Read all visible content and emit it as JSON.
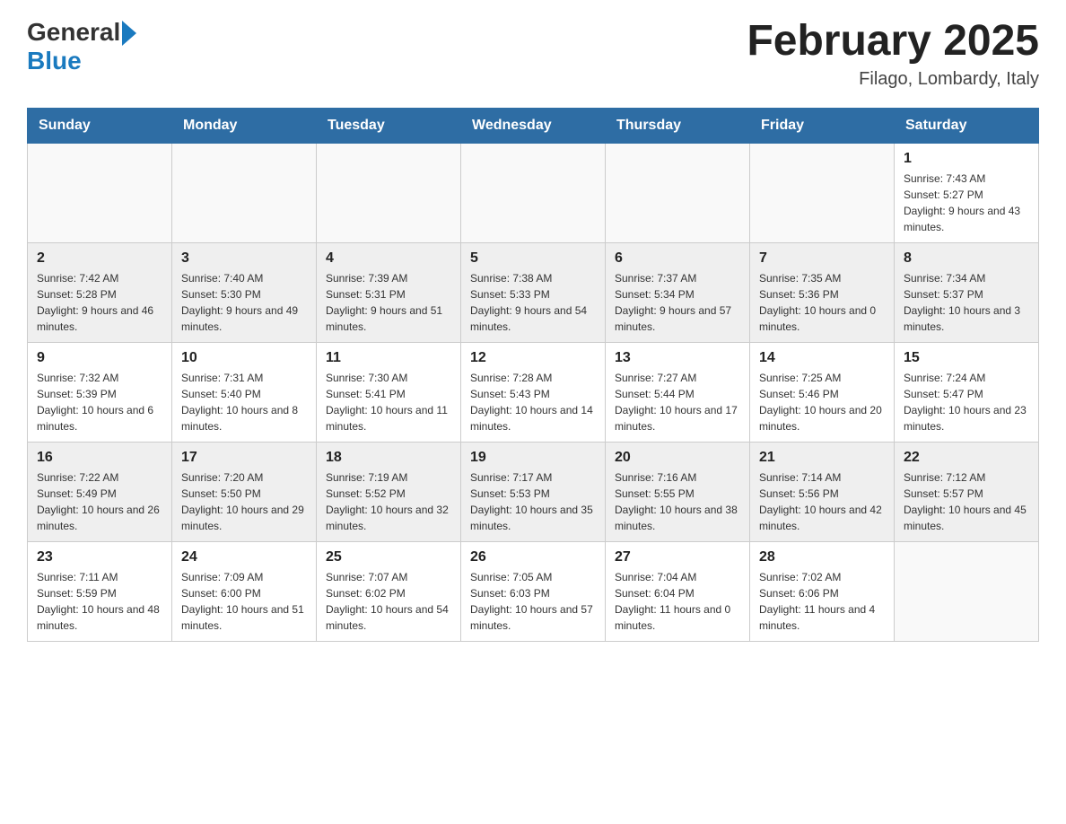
{
  "header": {
    "logo_general": "General",
    "logo_blue": "Blue",
    "title": "February 2025",
    "location": "Filago, Lombardy, Italy"
  },
  "weekdays": [
    "Sunday",
    "Monday",
    "Tuesday",
    "Wednesday",
    "Thursday",
    "Friday",
    "Saturday"
  ],
  "weeks": [
    {
      "days": [
        {
          "num": "",
          "info": ""
        },
        {
          "num": "",
          "info": ""
        },
        {
          "num": "",
          "info": ""
        },
        {
          "num": "",
          "info": ""
        },
        {
          "num": "",
          "info": ""
        },
        {
          "num": "",
          "info": ""
        },
        {
          "num": "1",
          "info": "Sunrise: 7:43 AM\nSunset: 5:27 PM\nDaylight: 9 hours and 43 minutes."
        }
      ]
    },
    {
      "days": [
        {
          "num": "2",
          "info": "Sunrise: 7:42 AM\nSunset: 5:28 PM\nDaylight: 9 hours and 46 minutes."
        },
        {
          "num": "3",
          "info": "Sunrise: 7:40 AM\nSunset: 5:30 PM\nDaylight: 9 hours and 49 minutes."
        },
        {
          "num": "4",
          "info": "Sunrise: 7:39 AM\nSunset: 5:31 PM\nDaylight: 9 hours and 51 minutes."
        },
        {
          "num": "5",
          "info": "Sunrise: 7:38 AM\nSunset: 5:33 PM\nDaylight: 9 hours and 54 minutes."
        },
        {
          "num": "6",
          "info": "Sunrise: 7:37 AM\nSunset: 5:34 PM\nDaylight: 9 hours and 57 minutes."
        },
        {
          "num": "7",
          "info": "Sunrise: 7:35 AM\nSunset: 5:36 PM\nDaylight: 10 hours and 0 minutes."
        },
        {
          "num": "8",
          "info": "Sunrise: 7:34 AM\nSunset: 5:37 PM\nDaylight: 10 hours and 3 minutes."
        }
      ]
    },
    {
      "days": [
        {
          "num": "9",
          "info": "Sunrise: 7:32 AM\nSunset: 5:39 PM\nDaylight: 10 hours and 6 minutes."
        },
        {
          "num": "10",
          "info": "Sunrise: 7:31 AM\nSunset: 5:40 PM\nDaylight: 10 hours and 8 minutes."
        },
        {
          "num": "11",
          "info": "Sunrise: 7:30 AM\nSunset: 5:41 PM\nDaylight: 10 hours and 11 minutes."
        },
        {
          "num": "12",
          "info": "Sunrise: 7:28 AM\nSunset: 5:43 PM\nDaylight: 10 hours and 14 minutes."
        },
        {
          "num": "13",
          "info": "Sunrise: 7:27 AM\nSunset: 5:44 PM\nDaylight: 10 hours and 17 minutes."
        },
        {
          "num": "14",
          "info": "Sunrise: 7:25 AM\nSunset: 5:46 PM\nDaylight: 10 hours and 20 minutes."
        },
        {
          "num": "15",
          "info": "Sunrise: 7:24 AM\nSunset: 5:47 PM\nDaylight: 10 hours and 23 minutes."
        }
      ]
    },
    {
      "days": [
        {
          "num": "16",
          "info": "Sunrise: 7:22 AM\nSunset: 5:49 PM\nDaylight: 10 hours and 26 minutes."
        },
        {
          "num": "17",
          "info": "Sunrise: 7:20 AM\nSunset: 5:50 PM\nDaylight: 10 hours and 29 minutes."
        },
        {
          "num": "18",
          "info": "Sunrise: 7:19 AM\nSunset: 5:52 PM\nDaylight: 10 hours and 32 minutes."
        },
        {
          "num": "19",
          "info": "Sunrise: 7:17 AM\nSunset: 5:53 PM\nDaylight: 10 hours and 35 minutes."
        },
        {
          "num": "20",
          "info": "Sunrise: 7:16 AM\nSunset: 5:55 PM\nDaylight: 10 hours and 38 minutes."
        },
        {
          "num": "21",
          "info": "Sunrise: 7:14 AM\nSunset: 5:56 PM\nDaylight: 10 hours and 42 minutes."
        },
        {
          "num": "22",
          "info": "Sunrise: 7:12 AM\nSunset: 5:57 PM\nDaylight: 10 hours and 45 minutes."
        }
      ]
    },
    {
      "days": [
        {
          "num": "23",
          "info": "Sunrise: 7:11 AM\nSunset: 5:59 PM\nDaylight: 10 hours and 48 minutes."
        },
        {
          "num": "24",
          "info": "Sunrise: 7:09 AM\nSunset: 6:00 PM\nDaylight: 10 hours and 51 minutes."
        },
        {
          "num": "25",
          "info": "Sunrise: 7:07 AM\nSunset: 6:02 PM\nDaylight: 10 hours and 54 minutes."
        },
        {
          "num": "26",
          "info": "Sunrise: 7:05 AM\nSunset: 6:03 PM\nDaylight: 10 hours and 57 minutes."
        },
        {
          "num": "27",
          "info": "Sunrise: 7:04 AM\nSunset: 6:04 PM\nDaylight: 11 hours and 0 minutes."
        },
        {
          "num": "28",
          "info": "Sunrise: 7:02 AM\nSunset: 6:06 PM\nDaylight: 11 hours and 4 minutes."
        },
        {
          "num": "",
          "info": ""
        }
      ]
    }
  ]
}
